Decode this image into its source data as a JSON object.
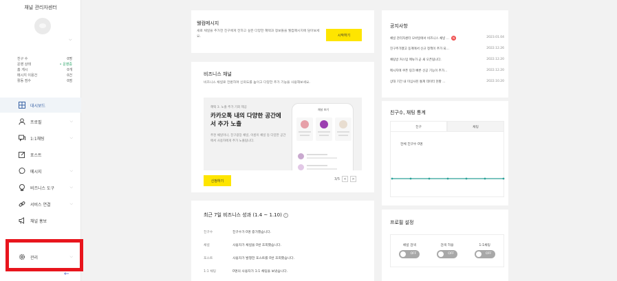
{
  "sidebar": {
    "title": "채널 관리자센터",
    "stats": [
      {
        "label": "친구 수",
        "value": "0명"
      },
      {
        "label": "운영 상태",
        "value": "• 운영중"
      },
      {
        "label": "홈 게시",
        "value": "0개"
      },
      {
        "label": "메시지 이용건",
        "value": "0건"
      },
      {
        "label": "활동 점수",
        "value": "0점"
      }
    ],
    "nav": [
      {
        "label": "대시보드",
        "icon": "dashboard-icon"
      },
      {
        "label": "프로필",
        "icon": "profile-icon"
      },
      {
        "label": "1:1채팅",
        "icon": "chat-icon"
      },
      {
        "label": "포스트",
        "icon": "post-icon"
      },
      {
        "label": "메시지",
        "icon": "message-icon"
      },
      {
        "label": "비즈니스 도구",
        "icon": "business-tools-icon"
      },
      {
        "label": "서비스 연결",
        "icon": "link-icon"
      },
      {
        "label": "채널 홍보",
        "icon": "megaphone-icon"
      },
      {
        "label": "관리",
        "icon": "gear-icon"
      }
    ],
    "collapse_arrow": "←"
  },
  "welcome": {
    "title": "웰컴메시지",
    "desc": "새로 채널을 추가한 친구에게 전하고 싶은 다양한 혜택과 정보들을 웰컴메시지에 담아보세요.",
    "button": "시작하기"
  },
  "biz": {
    "title": "비즈니스 채널",
    "desc": "비즈니스 채널로 전환하여 신뢰도를 높이고 다양한 추가 기능을 사용해보세요.",
    "promo_step": "혜택 3. 노출 추가 기회 제공",
    "promo_head": "카카오톡 내의 다양한 공간에서 추가 노출",
    "promo_sub": "추천 채널이나, 친구광장 채널, 이름이 채널 등 다양한 공간에서 사용자에게 추가 노출됩니다.",
    "phone_title": "채널 보기",
    "button": "신청하기",
    "pager": "3/5",
    "prev": "<",
    "next": ">"
  },
  "perf": {
    "title": "최근 7일 비즈니스 성과 (1.4 ~ 1.10)",
    "info_icon": "?",
    "rows": [
      {
        "k": "친구수",
        "v": "친구수가 0명 증가했습니다."
      },
      {
        "k": "채널",
        "v": "사용자가 채널을 0번 조회했습니다."
      },
      {
        "k": "포스트",
        "v": "사용자가 발행한 포스트를 0번 조회했습니다."
      },
      {
        "k": "1:1 채팅",
        "v": "0명의 사용자가 1:1 채팅을 보냈습니다."
      }
    ]
  },
  "notice": {
    "title": "공지사항",
    "items": [
      {
        "text": "채널 관리자센터 모바일에서 비즈니스 채널 ...",
        "date": "2023.01.04",
        "is_new": true,
        "new_label": "N"
      },
      {
        "text": "친구추가했고 동계에서 신규 정책이 추가 되...",
        "date": "2022.12.26",
        "is_new": false
      },
      {
        "text": "채팅방 커스텀 메뉴가 곧 새 오픈됩니다.",
        "date": "2022.12.20",
        "is_new": false
      },
      {
        "text": "메시지에 쿠폰 링크 빠른 선공 기능이 추가...",
        "date": "2022.12.20",
        "is_new": false
      },
      {
        "text": "상대 기간 내 미심사된 통계 데이터 현황 ...",
        "date": "2022.10.20",
        "is_new": false
      }
    ]
  },
  "friends": {
    "title": "친구수, 채팅 통계",
    "tabs": [
      "친구",
      "채팅"
    ],
    "active_tab": 0,
    "note": "전체 친구수 0명"
  },
  "chart_data": {
    "type": "line",
    "series": [
      {
        "values": [
          0,
          0,
          0,
          0,
          0,
          0,
          0
        ]
      }
    ],
    "color": "#2aa198"
  },
  "profile": {
    "title": "프로필 설정",
    "toggles": [
      {
        "label": "채널 검색",
        "state": "OFF"
      },
      {
        "label": "검색 허용",
        "state": "OFF"
      },
      {
        "label": "1:1채팅",
        "state": "OFF"
      }
    ]
  }
}
